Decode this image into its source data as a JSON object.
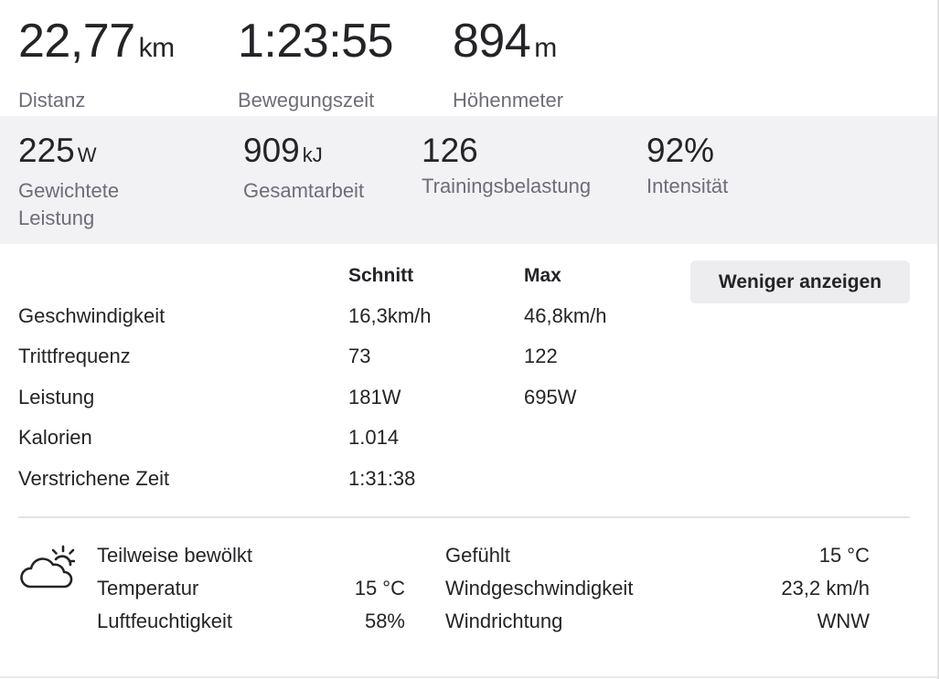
{
  "top_stats": [
    {
      "value": "22,77",
      "unit": "km",
      "label": "Distanz"
    },
    {
      "value": "1:23:55",
      "unit": "",
      "label": "Bewegungszeit"
    },
    {
      "value": "894",
      "unit": "m",
      "label": "Höhenmeter"
    }
  ],
  "secondary_stats": [
    {
      "value": "225",
      "unit": "W",
      "label_line1": "Gewichtete",
      "label_line2": "Leistung"
    },
    {
      "value": "909",
      "unit": "kJ",
      "label_line1": "Gesamtarbeit",
      "label_line2": ""
    },
    {
      "value": "126",
      "unit": "",
      "label_line1": "Trainingsbelastung",
      "label_line2": ""
    },
    {
      "value": "92%",
      "unit": "",
      "label_line1": "Intensität",
      "label_line2": ""
    }
  ],
  "metrics": {
    "headers": {
      "avg": "Schnitt",
      "max": "Max"
    },
    "toggle_label": "Weniger anzeigen",
    "rows": [
      {
        "label": "Geschwindigkeit",
        "avg": "16,3km/h",
        "max": "46,8km/h"
      },
      {
        "label": "Trittfrequenz",
        "avg": "73",
        "max": "122"
      },
      {
        "label": "Leistung",
        "avg": "181W",
        "max": "695W"
      },
      {
        "label": "Kalorien",
        "avg": "1.014",
        "max": ""
      },
      {
        "label": "Verstrichene Zeit",
        "avg": "1:31:38",
        "max": ""
      }
    ]
  },
  "weather": {
    "icon": "partly-cloudy-icon",
    "condition": "Teilweise bewölkt",
    "temperature_label": "Temperatur",
    "temperature_value": "15 °C",
    "humidity_label": "Luftfeuchtigkeit",
    "humidity_value": "58%",
    "feels_like_label": "Gefühlt",
    "feels_like_value": "15 °C",
    "wind_speed_label": "Windgeschwindigkeit",
    "wind_speed_value": "23,2 km/h",
    "wind_dir_label": "Windrichtung",
    "wind_dir_value": "WNW"
  }
}
